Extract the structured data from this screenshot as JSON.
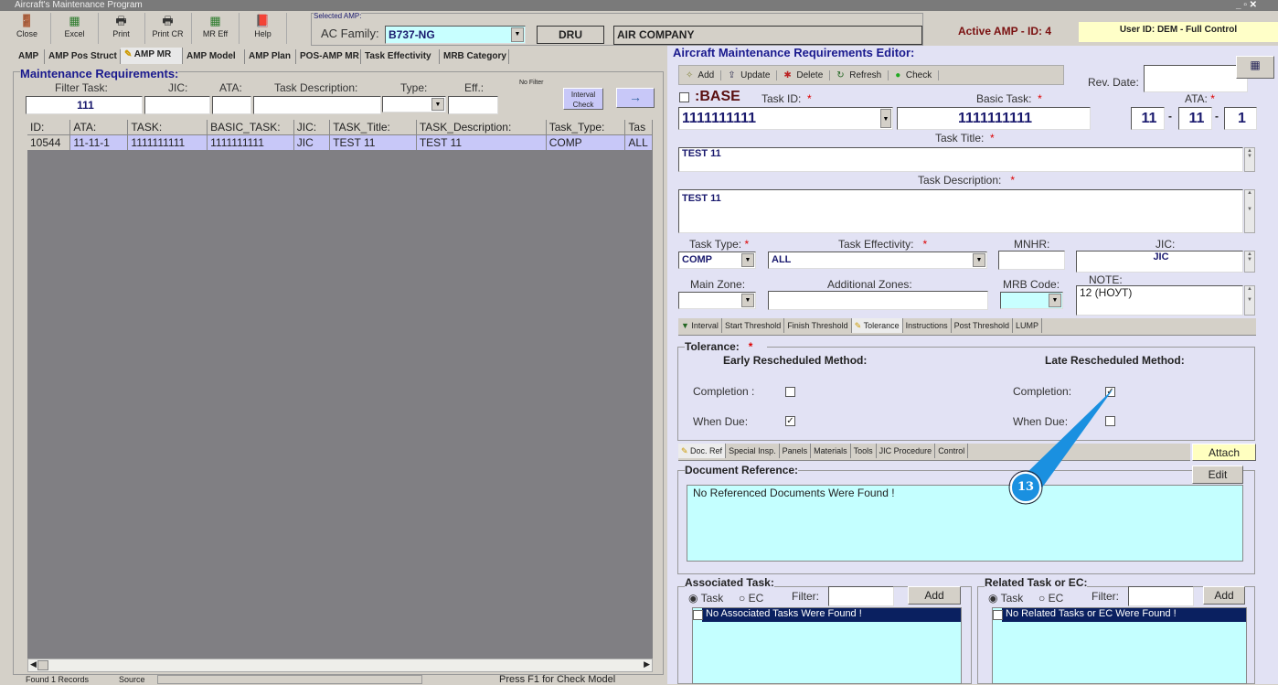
{
  "window": {
    "title": "Aircraft's Maintenance Program"
  },
  "toolbar": [
    {
      "label": "Close",
      "icon": "door-icon"
    },
    {
      "label": "Excel",
      "icon": "excel-icon"
    },
    {
      "label": "Print",
      "icon": "printer-icon"
    },
    {
      "label": "Print CR",
      "icon": "printer-icon"
    },
    {
      "label": "MR Eff",
      "icon": "excel-icon"
    },
    {
      "label": "Help",
      "icon": "help-book-icon"
    }
  ],
  "selected_amp": {
    "group_label": "Selected AMP:",
    "ac_family_label": "AC Family:",
    "ac_family_value": "B737-NG",
    "code": "DRU",
    "company": "AIR COMPANY"
  },
  "active_amp": "Active AMP - ID: 4",
  "user": "User ID: DEM - Full Control",
  "tabs": [
    "AMP",
    "AMP Pos Struct",
    "AMP MR",
    "AMP Model",
    "AMP Plan",
    "POS-AMP MR",
    "Task Effectivity",
    "MRB Category"
  ],
  "left": {
    "title": "Maintenance Requirements:",
    "filters": {
      "task_label": "Filter Task:",
      "task_value": "111",
      "jic_label": "JIC:",
      "ata_label": "ATA:",
      "desc_label": "Task Description:",
      "type_label": "Type:",
      "eff_label": "Eff.:",
      "no_filter": "No Filter",
      "interval_check": "Interval Check",
      "arrow": "→"
    },
    "columns": [
      "ID:",
      "ATA:",
      "TASK:",
      "BASIC_TASK:",
      "JIC:",
      "TASK_Title:",
      "TASK_Description:",
      "Task_Type:",
      "Tas"
    ],
    "rows": [
      [
        "10544",
        "11-11-1",
        "1111111111",
        "1111111111",
        "JIC",
        "TEST 11",
        "TEST 11",
        "COMP",
        "ALL"
      ]
    ],
    "status": {
      "records": "Found 1 Records",
      "source": "Source",
      "hint": "Press F1 for Check Model"
    }
  },
  "editor": {
    "title": "Aircraft Maintenance Requirements Editor:",
    "actions": [
      "Add",
      "Update",
      "Delete",
      "Refresh",
      "Check"
    ],
    "rev_date_label": "Rev. Date:",
    "rev_date": "",
    "base_label": ":BASE",
    "task_id_label": "Task ID:",
    "task_id": "1111111111",
    "basic_task_label": "Basic Task:",
    "basic_task": "1111111111",
    "ata_label": "ATA:",
    "ata": [
      "11",
      "11",
      "1"
    ],
    "task_title_label": "Task Title:",
    "task_title": "TEST 11",
    "task_desc_label": "Task Description:",
    "task_desc": "TEST 11",
    "task_type_label": "Task Type:",
    "task_type": "COMP",
    "task_eff_label": "Task Effectivity:",
    "task_eff": "ALL",
    "mnhr_label": "MNHR:",
    "mnhr": "",
    "jic_label": "JIC:",
    "jic": "JIC",
    "main_zone_label": "Main Zone:",
    "add_zones_label": "Additional Zones:",
    "mrb_label": "MRB Code:",
    "note_label": "NOTE:",
    "note": "12 (НОУТ)",
    "subtabs": [
      "Interval",
      "Start Threshold",
      "Finish Threshold",
      "Tolerance",
      "Instructions",
      "Post Threshold",
      "LUMP"
    ],
    "tolerance": {
      "title": "Tolerance:",
      "early": "Early Rescheduled Method:",
      "late": "Late Rescheduled Method:",
      "completion": "Completion :",
      "completion2": "Completion:",
      "when_due": "When Due:",
      "early_completion": false,
      "early_when_due": true,
      "late_completion": true,
      "late_when_due": false
    },
    "doctabs": [
      "Doc. Ref",
      "Special Insp.",
      "Panels",
      "Materials",
      "Tools",
      "JIC Procedure",
      "Control"
    ],
    "attach": "Attach",
    "docref": {
      "title": "Document Reference:",
      "edit": "Edit",
      "empty": "No Referenced Documents Were Found !"
    },
    "assoc": {
      "title": "Associated Task:",
      "task": "Task",
      "ec": "EC",
      "filter": "Filter:",
      "add": "Add",
      "empty": "No Associated Tasks Were Found !"
    },
    "related": {
      "title": "Related Task or EC:",
      "task": "Task",
      "ec": "EC",
      "filter": "Filter:",
      "add": "Add",
      "empty": "No Related Tasks or EC Were Found !"
    }
  },
  "callout": {
    "number": "13",
    "color": "#1a90e0"
  }
}
